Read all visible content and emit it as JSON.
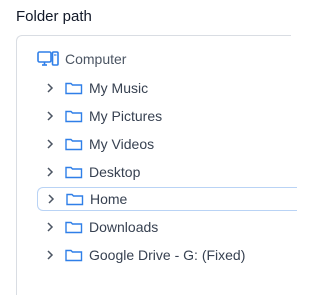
{
  "label": "Folder path",
  "tree": {
    "root": {
      "label": "Computer",
      "icon": "computer-icon"
    },
    "items": [
      {
        "label": "My Music",
        "selected": false
      },
      {
        "label": "My Pictures",
        "selected": false
      },
      {
        "label": "My Videos",
        "selected": false
      },
      {
        "label": "Desktop",
        "selected": false
      },
      {
        "label": "Home",
        "selected": true
      },
      {
        "label": "Downloads",
        "selected": false
      },
      {
        "label": "Google Drive - G: (Fixed)",
        "selected": false
      }
    ]
  },
  "colors": {
    "accent": "#2f7fe8",
    "selected_border": "#b9d3f5",
    "border": "#d9dde3"
  }
}
